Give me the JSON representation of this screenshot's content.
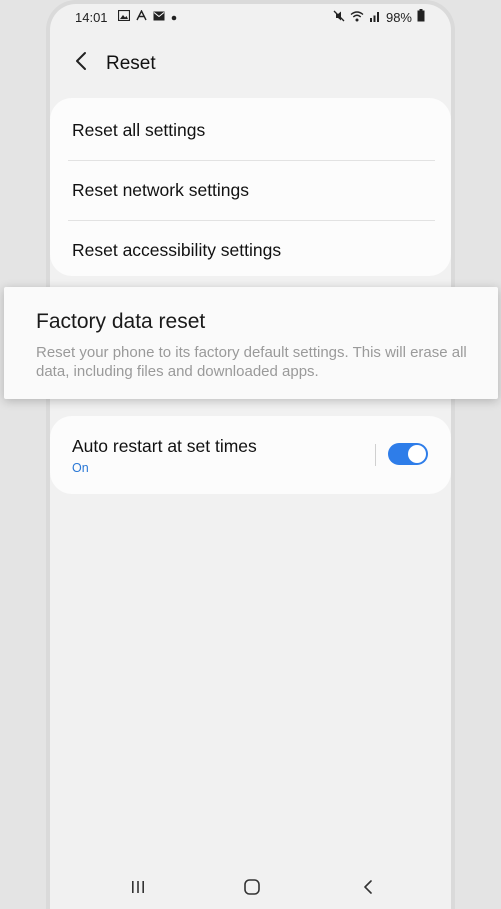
{
  "status_bar": {
    "time": "14:01",
    "battery": "98%",
    "left_icons": [
      "gallery-icon",
      "font-icon",
      "email-icon",
      "dot-icon"
    ],
    "right_icons": [
      "mute-icon",
      "wifi-icon",
      "signal-icon",
      "battery-icon"
    ]
  },
  "header": {
    "title": "Reset",
    "back_icon": "back-arrow-icon"
  },
  "reset_options": [
    {
      "label": "Reset all settings"
    },
    {
      "label": "Reset network settings"
    },
    {
      "label": "Reset accessibility settings"
    }
  ],
  "factory_reset": {
    "title": "Factory data reset",
    "description": "Reset your phone to its factory default settings. This will erase all data, including files and downloaded apps."
  },
  "auto_restart": {
    "label": "Auto restart at set times",
    "status": "On",
    "enabled": true
  },
  "navigation_bar": {
    "buttons": [
      "recents-icon",
      "home-icon",
      "back-icon"
    ]
  },
  "colors": {
    "accent": "#2e7de9",
    "status_text": "#2a78d6",
    "background": "#f1f1f1",
    "card": "#fcfcfc"
  }
}
